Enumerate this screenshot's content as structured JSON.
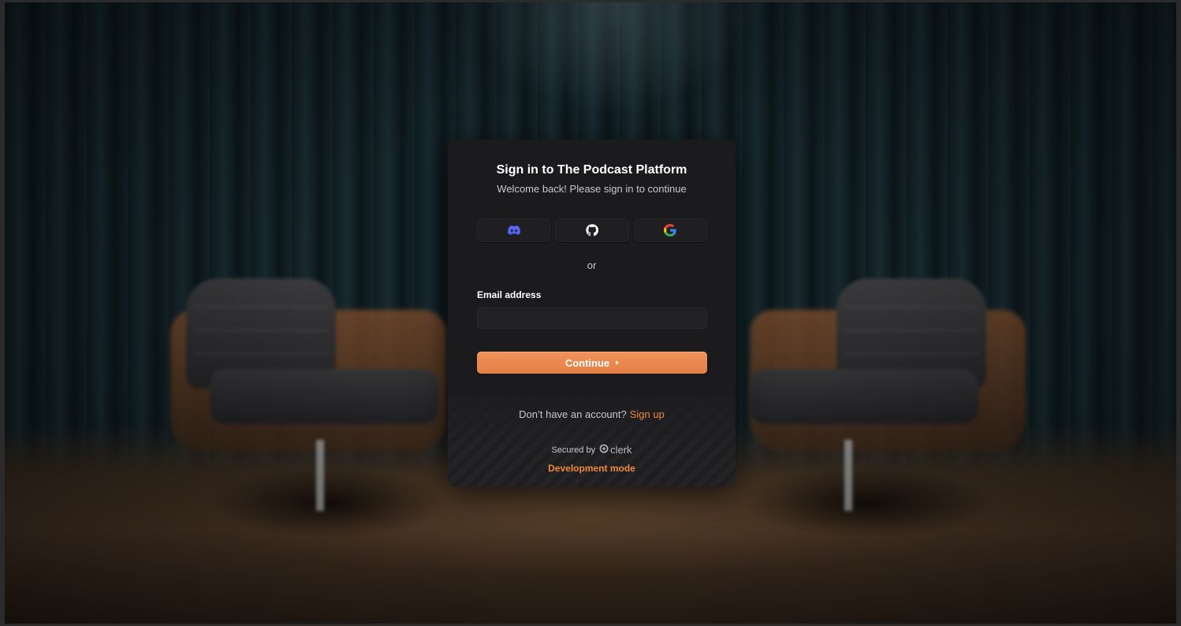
{
  "background": {
    "description_icon": "podcast-studio-background"
  },
  "card": {
    "title": "Sign in to The Podcast Platform",
    "subtitle": "Welcome back! Please sign in to continue",
    "social_buttons": [
      {
        "provider": "Discord",
        "icon": "discord-icon"
      },
      {
        "provider": "GitHub",
        "icon": "github-icon"
      },
      {
        "provider": "Google",
        "icon": "google-icon"
      }
    ],
    "divider_text": "or",
    "email_label": "Email address",
    "email_value": "",
    "email_placeholder": "",
    "continue_label": "Continue",
    "signup_prompt": "Don’t have an account?",
    "signup_link": "Sign up",
    "secured_by": "Secured by",
    "clerk_brand": "clerk",
    "dev_mode": "Development mode"
  },
  "colors": {
    "accent": "#e8874c",
    "link": "#f0893f",
    "card_bg": "#1b1b1d",
    "discord": "#5865f2"
  }
}
